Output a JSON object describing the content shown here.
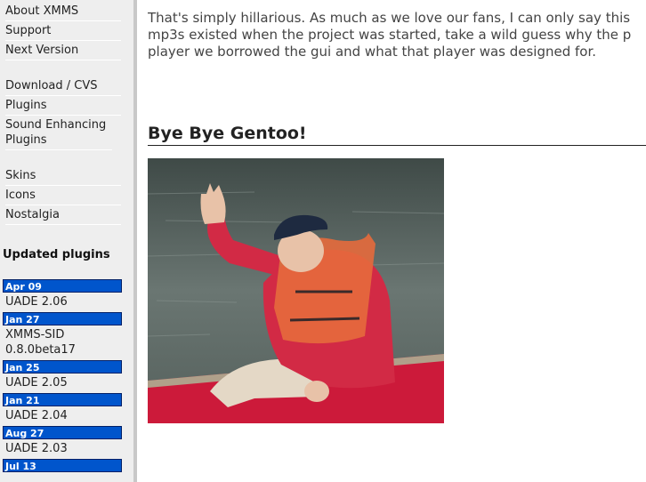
{
  "sidebar": {
    "group1": [
      "About XMMS",
      "Support",
      "Next Version"
    ],
    "group2": [
      "Download / CVS",
      "Plugins",
      "Sound Enhancing Plugins"
    ],
    "group3": [
      "Skins",
      "Icons",
      "Nostalgia"
    ],
    "updated_heading": "Updated plugins",
    "updates": [
      {
        "date": "Apr 09",
        "name": "UADE 2.06"
      },
      {
        "date": "Jan 27",
        "name": "XMMS-SID 0.8.0beta17"
      },
      {
        "date": "Jan 25",
        "name": "UADE 2.05"
      },
      {
        "date": "Jan 21",
        "name": "UADE 2.04"
      },
      {
        "date": "Aug 27",
        "name": "UADE 2.03"
      },
      {
        "date": "Jul 13",
        "name": ""
      }
    ]
  },
  "main": {
    "intro_lines": [
      "That's simply hillarious. As much as we love our fans, I can only say this",
      "mp3s existed when the project was started, take a wild guess why the p",
      "player we borrowed the gui and what that player was designed for."
    ],
    "news_heading": "Bye Bye Gentoo!"
  },
  "colors": {
    "date_bar": "#0055cc",
    "sidebar_bg": "#eeeeee",
    "canoe": "#cc1a3a",
    "jacket": "#d22a45",
    "water": "#52605c"
  }
}
